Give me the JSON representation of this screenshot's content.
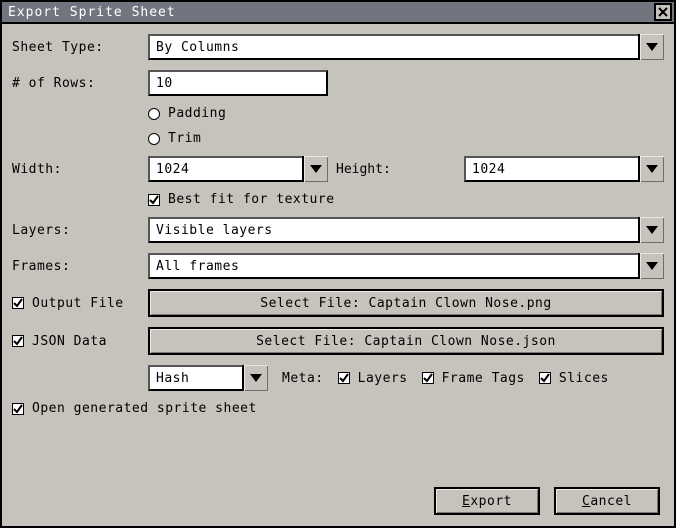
{
  "window": {
    "title": "Export Sprite Sheet"
  },
  "labels": {
    "sheet_type": "Sheet Type:",
    "rows": "# of Rows:",
    "width": "Width:",
    "height": "Height:",
    "layers": "Layers:",
    "frames": "Frames:",
    "meta": "Meta:"
  },
  "fields": {
    "sheet_type": "By Columns",
    "rows": "10",
    "width": "1024",
    "height": "1024",
    "layers": "Visible layers",
    "frames": "All frames",
    "output_file_btn": "Select File: Captain Clown Nose.png",
    "json_file_btn": "Select File: Captain Clown Nose.json",
    "json_format": "Hash"
  },
  "checks": {
    "padding": {
      "label": "Padding",
      "checked": false
    },
    "trim": {
      "label": "Trim",
      "checked": false
    },
    "best_fit": {
      "label": "Best fit for texture",
      "checked": true
    },
    "output_file": {
      "label": "Output File",
      "checked": true
    },
    "json_data": {
      "label": "JSON Data",
      "checked": true
    },
    "meta_layers": {
      "label": "Layers",
      "checked": true
    },
    "meta_frame_tags": {
      "label": "Frame Tags",
      "checked": true
    },
    "meta_slices": {
      "label": "Slices",
      "checked": true
    },
    "open_generated": {
      "label": "Open generated sprite sheet",
      "checked": true
    }
  },
  "buttons": {
    "export": "Export",
    "cancel": "Cancel"
  }
}
